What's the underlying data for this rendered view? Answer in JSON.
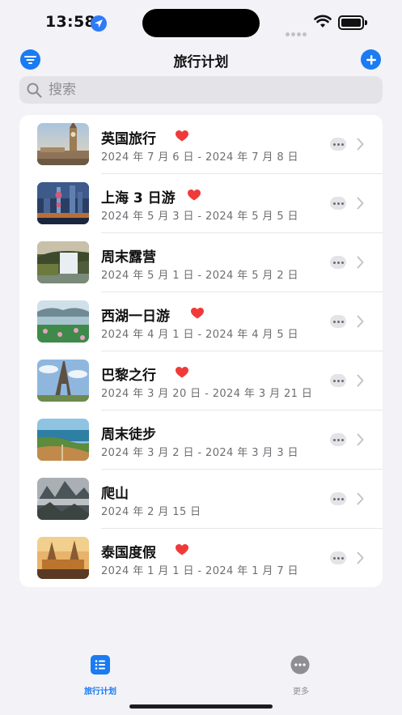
{
  "status_bar": {
    "time": "13:58"
  },
  "nav": {
    "title": "旅行计划"
  },
  "search": {
    "placeholder": "搜索",
    "value": ""
  },
  "trips": [
    {
      "name": "英国旅行",
      "dates": "2024 年 7 月 6 日 - 2024 年 7 月 8 日",
      "favorite": true,
      "photo": "london-big-ben"
    },
    {
      "name": "上海 3 日游",
      "dates": "2024 年 5 月 3 日 - 2024 年 5 月 5 日",
      "favorite": true,
      "photo": "shanghai-skyline"
    },
    {
      "name": "周末露营",
      "dates": "2024 年 5 月 1 日 - 2024 年 5 月 2 日",
      "favorite": false,
      "photo": "waterfall"
    },
    {
      "name": "西湖一日游",
      "dates": "2024 年 4 月 1 日 - 2024 年 4 月 5 日",
      "favorite": true,
      "photo": "west-lake"
    },
    {
      "name": "巴黎之行",
      "dates": "2024 年 3 月 20 日 - 2024 年 3 月 21 日",
      "favorite": true,
      "photo": "eiffel-tower"
    },
    {
      "name": "周末徒步",
      "dates": "2024 年 3 月 2 日 - 2024 年 3 月 3 日",
      "favorite": false,
      "photo": "coastline"
    },
    {
      "name": "爬山",
      "dates": "2024 年 2 月 15 日",
      "favorite": false,
      "photo": "misty-mountains"
    },
    {
      "name": "泰国度假",
      "dates": "2024 年 1 月 1 日 - 2024 年 1 月 7 日",
      "favorite": true,
      "photo": "thai-temple"
    }
  ],
  "tab_bar": {
    "tabs": [
      {
        "label": "旅行计划",
        "icon": "list-icon",
        "selected": true
      },
      {
        "label": "更多",
        "icon": "ellipsis-icon",
        "selected": false
      }
    ]
  },
  "colors": {
    "accent": "#1a7bf2",
    "heart": "#f03a3a",
    "background": "#f2f2f7"
  }
}
